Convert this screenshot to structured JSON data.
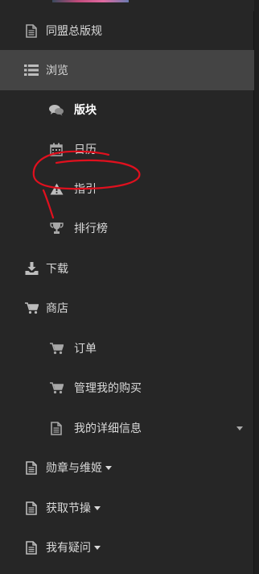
{
  "sidebar": {
    "items": [
      {
        "label": "同盟总版规",
        "icon": "file-icon"
      },
      {
        "label": "浏览",
        "icon": "list-icon",
        "active": true
      },
      {
        "label": "版块",
        "icon": "comments-icon"
      },
      {
        "label": "日历",
        "icon": "calendar-icon"
      },
      {
        "label": "指引",
        "icon": "warning-icon"
      },
      {
        "label": "排行榜",
        "icon": "trophy-icon"
      },
      {
        "label": "下载",
        "icon": "download-icon"
      },
      {
        "label": "商店",
        "icon": "cart-icon"
      },
      {
        "label": "订单",
        "icon": "cart-icon"
      },
      {
        "label": "管理我的购买",
        "icon": "cart-icon"
      },
      {
        "label": "我的详细信息",
        "icon": "file-icon"
      },
      {
        "label": "勋章与维姬",
        "icon": "file-icon"
      },
      {
        "label": "获取节操",
        "icon": "file-icon"
      },
      {
        "label": "我有疑问",
        "icon": "file-icon"
      }
    ]
  },
  "colors": {
    "background": "#262626",
    "active_background": "#444444",
    "text": "#d9d9d9",
    "icon": "#a8a8a8",
    "annotation": "#e0101e"
  }
}
